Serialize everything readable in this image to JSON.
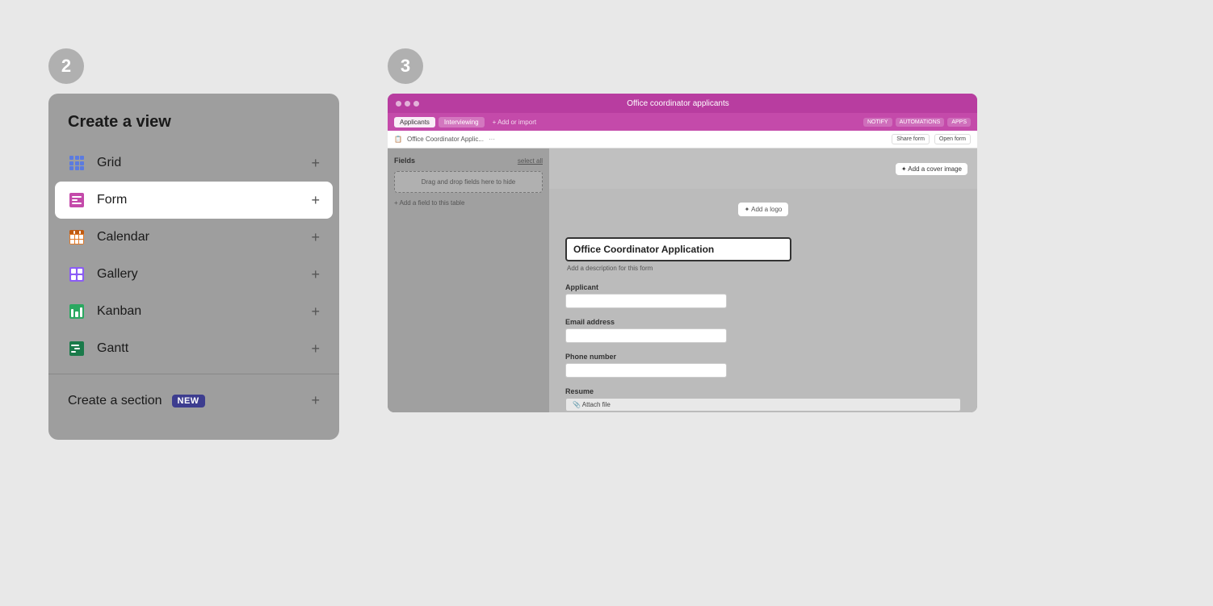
{
  "step2": {
    "number": "2",
    "title": "Create a view",
    "items": [
      {
        "id": "grid",
        "label": "Grid",
        "icon": "grid-icon"
      },
      {
        "id": "form",
        "label": "Form",
        "icon": "form-icon",
        "active": true
      },
      {
        "id": "calendar",
        "label": "Calendar",
        "icon": "calendar-icon"
      },
      {
        "id": "gallery",
        "label": "Gallery",
        "icon": "gallery-icon"
      },
      {
        "id": "kanban",
        "label": "Kanban",
        "icon": "kanban-icon"
      },
      {
        "id": "gantt",
        "label": "Gantt",
        "icon": "gantt-icon"
      }
    ],
    "create_section_label": "Create a section",
    "new_badge": "NEW",
    "plus_symbol": "+"
  },
  "step3": {
    "number": "3",
    "topbar": {
      "title": "Office coordinator applicants"
    },
    "tabs": [
      {
        "label": "Applicants",
        "active": true
      },
      {
        "label": "Interviewing",
        "active": false
      }
    ],
    "tab_action": "+ Add or import",
    "right_actions": [
      "NOTIFY",
      "AUTOMATIONS",
      "APP"
    ],
    "toolbar": {
      "breadcrumb": "Office Coordinator Applic...",
      "share_form": "Share form",
      "open_form": "Open form"
    },
    "sidebar": {
      "header_label": "Fields",
      "header_link": "select all",
      "drop_zone": "Drag and drop fields here to hide",
      "add_field": "+ Add a field to this table"
    },
    "form": {
      "cover_button": "✦ Add a cover image",
      "logo_button": "✦ Add a logo",
      "title": "Office Coordinator Application",
      "description": "Add a description for this form",
      "fields": [
        {
          "label": "Applicant",
          "type": "text"
        },
        {
          "label": "Email address",
          "type": "text"
        },
        {
          "label": "Phone number",
          "type": "text"
        },
        {
          "label": "Resume",
          "type": "file",
          "attach_label": "📎 Attach file"
        }
      ]
    }
  }
}
